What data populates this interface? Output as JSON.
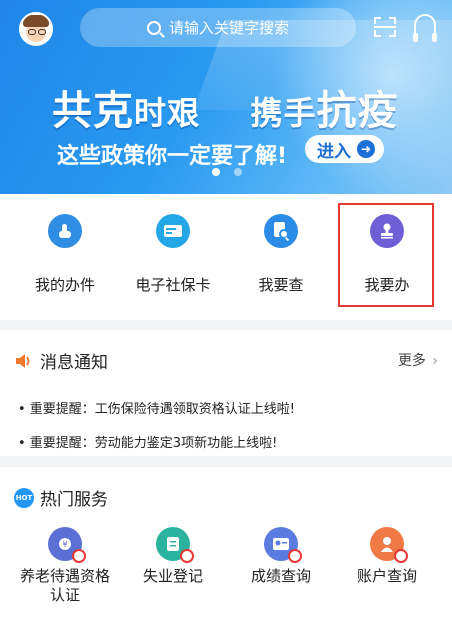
{
  "header": {
    "search_placeholder": "请输入关键字搜索"
  },
  "banner": {
    "title_part1": "共克",
    "title_part2": "时艰",
    "title_part3": "携手",
    "title_part4": "抗疫",
    "subtitle": "这些政策你一定要了解!",
    "enter_label": "进入"
  },
  "quick": [
    {
      "label": "我的办件",
      "color": "#2f8de4"
    },
    {
      "label": "电子社保卡",
      "color": "#24a7e6"
    },
    {
      "label": "我要查",
      "color": "#2a8ce6"
    },
    {
      "label": "我要办",
      "color": "#6f5fd6"
    }
  ],
  "notice": {
    "title": "消息通知",
    "more": "更多",
    "items": [
      "• 重要提醒：工伤保险待遇领取资格认证上线啦!",
      "• 重要提醒：劳动能力鉴定3项新功能上线啦!"
    ]
  },
  "hot": {
    "badge": "HOT",
    "title": "热门服务",
    "items": [
      {
        "label": "养老待遇资格认证",
        "color": "#5b6fd4"
      },
      {
        "label": "失业登记",
        "color": "#2bb3a0"
      },
      {
        "label": "成绩查询",
        "color": "#5a7be0"
      },
      {
        "label": "账户查询",
        "color": "#f07a45"
      }
    ]
  }
}
